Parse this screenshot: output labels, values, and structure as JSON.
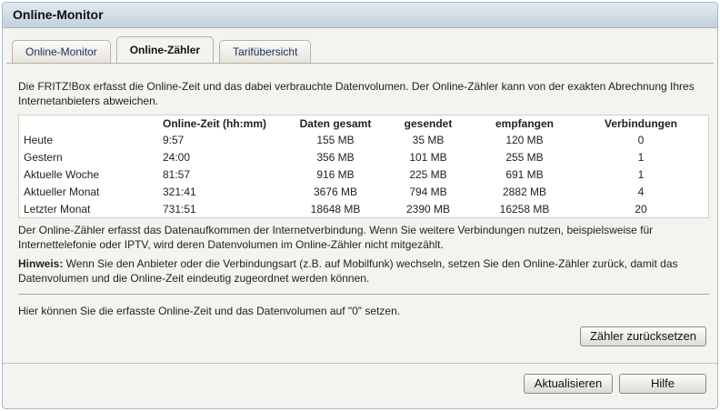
{
  "window": {
    "title": "Online-Monitor"
  },
  "tabs": [
    {
      "label": "Online-Monitor",
      "active": false
    },
    {
      "label": "Online-Zähler",
      "active": true
    },
    {
      "label": "Tarifübersicht",
      "active": false
    }
  ],
  "intro": "Die FRITZ!Box erfasst die Online-Zeit und das dabei verbrauchte Datenvolumen. Der Online-Zähler kann von der exakten Abrechnung Ihres Internetanbieters abweichen.",
  "table": {
    "headers": [
      "",
      "Online-Zeit (hh:mm)",
      "Daten gesamt",
      "gesendet",
      "empfangen",
      "Verbindungen"
    ],
    "rows": [
      [
        "Heute",
        "9:57",
        "155 MB",
        "35 MB",
        "120 MB",
        "0"
      ],
      [
        "Gestern",
        "24:00",
        "356 MB",
        "101 MB",
        "255 MB",
        "1"
      ],
      [
        "Aktuelle Woche",
        "81:57",
        "916 MB",
        "225 MB",
        "691 MB",
        "1"
      ],
      [
        "Aktueller Monat",
        "321:41",
        "3676 MB",
        "794 MB",
        "2882 MB",
        "4"
      ],
      [
        "Letzter Monat",
        "731:51",
        "18648 MB",
        "2390 MB",
        "16258 MB",
        "20"
      ]
    ]
  },
  "note": "Der Online-Zähler erfasst das Datenaufkommen der Internetverbindung. Wenn Sie weitere Verbindungen nutzen, beispielsweise für Internettelefonie oder IPTV, wird deren Datenvolumen im Online-Zähler nicht mitgezählt.",
  "hint": {
    "label": "Hinweis:",
    "text": " Wenn Sie den Anbieter oder die Verbindungsart (z.B. auf Mobilfunk) wechseln, setzen Sie den Online-Zähler zurück, damit das Datenvolumen und die Online-Zeit eindeutig zugeordnet werden können."
  },
  "reset": {
    "text": "Hier können Sie die erfasste Online-Zeit und das Datenvolumen auf \"0\" setzen.",
    "button": "Zähler zurücksetzen"
  },
  "footer": {
    "refresh": "Aktualisieren",
    "help": "Hilfe"
  }
}
